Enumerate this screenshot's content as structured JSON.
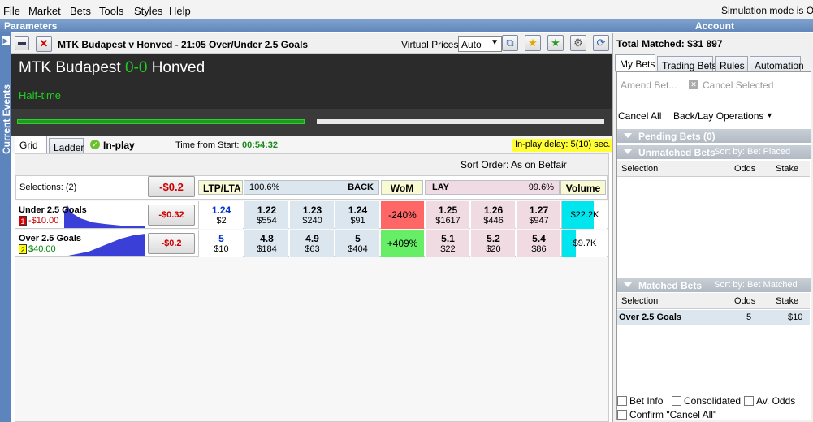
{
  "menu": {
    "file": "File",
    "market": "Market",
    "bets": "Bets",
    "tools": "Tools",
    "styles": "Styles",
    "help": "Help",
    "simulation": "Simulation mode is O"
  },
  "panels": {
    "parameters": "Parameters",
    "account": "Account",
    "current_events": "Current Events"
  },
  "market": {
    "title": "MTK Budapest v Honved - 21:05 Over/Under 2.5 Goals",
    "virtual_prices_label": "Virtual Prices:",
    "virtual_prices_value": "Auto",
    "team_home": "MTK Budapest",
    "score": "0-0",
    "team_away": "Honved",
    "status": "Half-time",
    "progress_home": 0.68
  },
  "total_matched": "Total Matched: $31 897",
  "tabs": {
    "grid": "Grid",
    "ladder": "Ladder",
    "inplay": "In-play",
    "time_label": "Time from Start:",
    "time_value": "00:54:32",
    "delay": "In-play delay: 5(10) sec."
  },
  "sort_order": "Sort Order: As on Betfair",
  "grid": {
    "selections": "Selections: (2)",
    "pl_total": "-$0.2",
    "headers": {
      "ltp": "LTP/LTA",
      "back_pct": "100.6%",
      "back": "BACK",
      "wom": "WoM",
      "lay": "LAY",
      "lay_pct": "99.6%",
      "volume": "Volume"
    },
    "rows": [
      {
        "name": "Under 2.5 Goals",
        "num": "1",
        "pl": "-$10.00",
        "pl_btn": "-$0.32",
        "ltp": "1.24",
        "lta": "$2",
        "back": [
          {
            "odds": "1.22",
            "amt": "$554"
          },
          {
            "odds": "1.23",
            "amt": "$240"
          },
          {
            "odds": "1.24",
            "amt": "$91"
          }
        ],
        "wom": "-240%",
        "lay": [
          {
            "odds": "1.25",
            "amt": "$1617"
          },
          {
            "odds": "1.26",
            "amt": "$446"
          },
          {
            "odds": "1.27",
            "amt": "$947"
          }
        ],
        "volume": "$22.2K",
        "volume_fill": 0.7
      },
      {
        "name": "Over 2.5 Goals",
        "num": "2",
        "pl": "$40.00",
        "pl_btn": "-$0.2",
        "ltp": "5",
        "lta": "$10",
        "back": [
          {
            "odds": "4.8",
            "amt": "$184"
          },
          {
            "odds": "4.9",
            "amt": "$63"
          },
          {
            "odds": "5",
            "amt": "$404"
          }
        ],
        "wom": "+409%",
        "lay": [
          {
            "odds": "5.1",
            "amt": "$22"
          },
          {
            "odds": "5.2",
            "amt": "$20"
          },
          {
            "odds": "5.4",
            "amt": "$86"
          }
        ],
        "volume": "$9.7K",
        "volume_fill": 0.3
      }
    ]
  },
  "right": {
    "tabs": [
      "My Bets",
      "Trading Bets",
      "Rules",
      "Automation"
    ],
    "amend": "Amend Bet...",
    "cancel_selected": "Cancel Selected",
    "cancel_all": "Cancel All",
    "back_lay_ops": "Back/Lay Operations",
    "pending": "Pending Bets (0)",
    "unmatched": "Unmatched Bets",
    "unmatched_sort": "Sort by: Bet Placed",
    "matched": "Matched Bets",
    "matched_sort": "Sort by: Bet Matched",
    "cols": {
      "selection": "Selection",
      "odds": "Odds",
      "stake": "Stake"
    },
    "matched_rows": [
      {
        "selection": "Over 2.5 Goals",
        "odds": "5",
        "stake": "$10"
      }
    ],
    "options": {
      "bet_info": "Bet Info",
      "consolidated": "Consolidated",
      "av_odds": "Av. Odds",
      "confirm_cancel": "Confirm \"Cancel All\""
    }
  },
  "colors": {
    "back": "#dbe6ef",
    "lay": "#f0dbe3",
    "wom_neg": "#ff6666",
    "wom_pos": "#66ee66",
    "volume": "#00e5ee",
    "score": "#22cc22",
    "status": "#22cc22"
  }
}
